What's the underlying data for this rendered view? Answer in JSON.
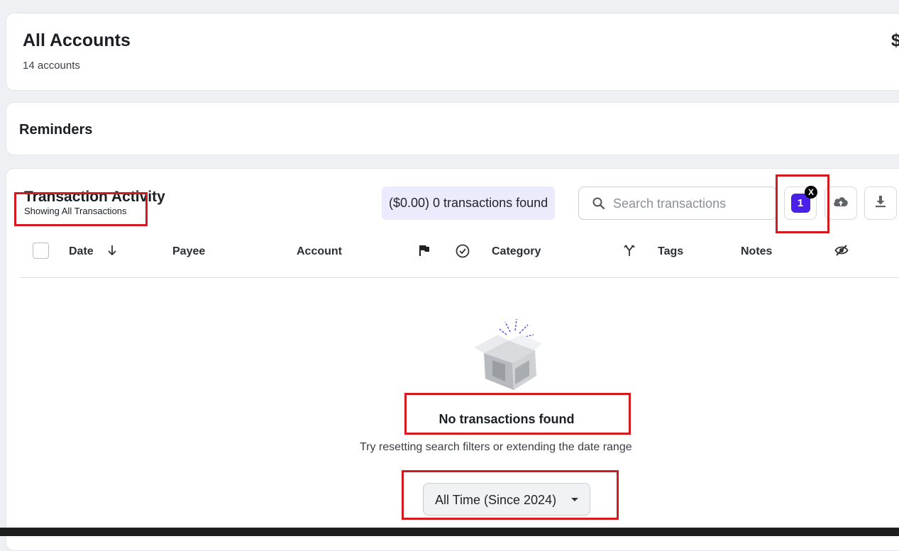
{
  "accounts": {
    "title": "All Accounts",
    "count_text": "14 accounts",
    "total_partial": "$"
  },
  "reminders": {
    "title": "Reminders"
  },
  "transactions": {
    "title": "Transaction Activity",
    "subtitle": "Showing All Transactions",
    "summary": "($0.00) 0 transactions found",
    "search": {
      "placeholder": "Search transactions",
      "icon": "search-icon"
    },
    "filter": {
      "count": "1",
      "clear_label": "X"
    },
    "upload_icon": "cloud-upload-icon",
    "download_icon": "download-icon",
    "columns": {
      "date": "Date",
      "payee": "Payee",
      "account": "Account",
      "category": "Category",
      "tags": "Tags",
      "notes": "Notes"
    },
    "empty": {
      "title": "No transactions found",
      "hint": "Try resetting search filters or extending the date range"
    },
    "date_range": "All Time (Since 2024)"
  },
  "colors": {
    "accent": "#4a1fe8",
    "summary_bg": "#ecebfd",
    "annotation": "#d6191f"
  }
}
